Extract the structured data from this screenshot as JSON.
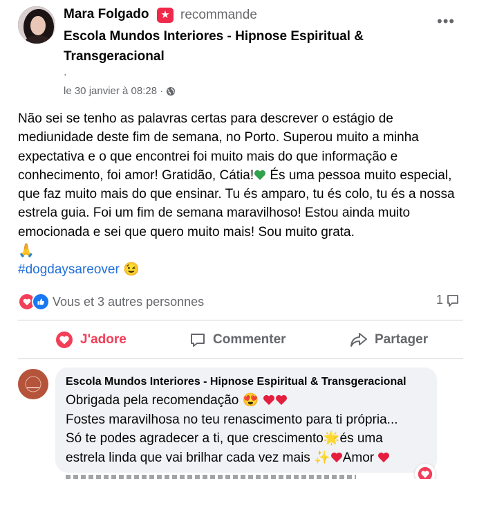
{
  "post": {
    "author": "Mara Folgado",
    "action": "recommande",
    "page_name": "Escola Mundos Interiores - Hipnose Espiritual & Transgeracional",
    "dot": ".",
    "date": "le 30 janvier à 08:28",
    "separator": "·",
    "audience_icon": "globe-icon",
    "text_part1": "Não sei se tenho as palavras certas para descrever o estágio de mediunidade deste fim de semana, no Porto. Superou muito a minha expectativa e o que encontrei foi muito mais do que informação e conhecimento, foi amor! Gratidão, Cátia!",
    "text_part2": " És uma pessoa muito especial, que faz muito mais do que ensinar. Tu és amparo, tu és colo, tu és a nossa estrela guia. Foi um fim de semana maravilhoso! Estou ainda muito emocionada e sei que quero muito mais! Sou muito grata.",
    "emoji_pray": "🙏",
    "hashtag": "#dogdaysareover",
    "emoji_wink": "😉"
  },
  "reactions": {
    "text": "Vous et 3 autres personnes",
    "comment_count": "1"
  },
  "actions": {
    "love_label": "J'adore",
    "comment_label": "Commenter",
    "share_label": "Partager"
  },
  "comment": {
    "author": "Escola Mundos Interiores - Hipnose Espiritual & Transgeracional",
    "line1": "Obrigada pela recomendação 😍 ",
    "line2": "Fostes maravilhosa no teu renascimento para ti própria...",
    "line3a": "Só te podes agradecer a ti, que crescimento",
    "emoji_star": "🌟",
    "line3b": "és uma",
    "line4a": "estrela linda que vai brilhar cada vez mais ✨",
    "line4b": "Amor "
  },
  "colors": {
    "love": "#f33e58",
    "like": "#1877f2",
    "link": "#216fdb",
    "green_heart": "#31a24c",
    "star_badge": "#f02849"
  }
}
